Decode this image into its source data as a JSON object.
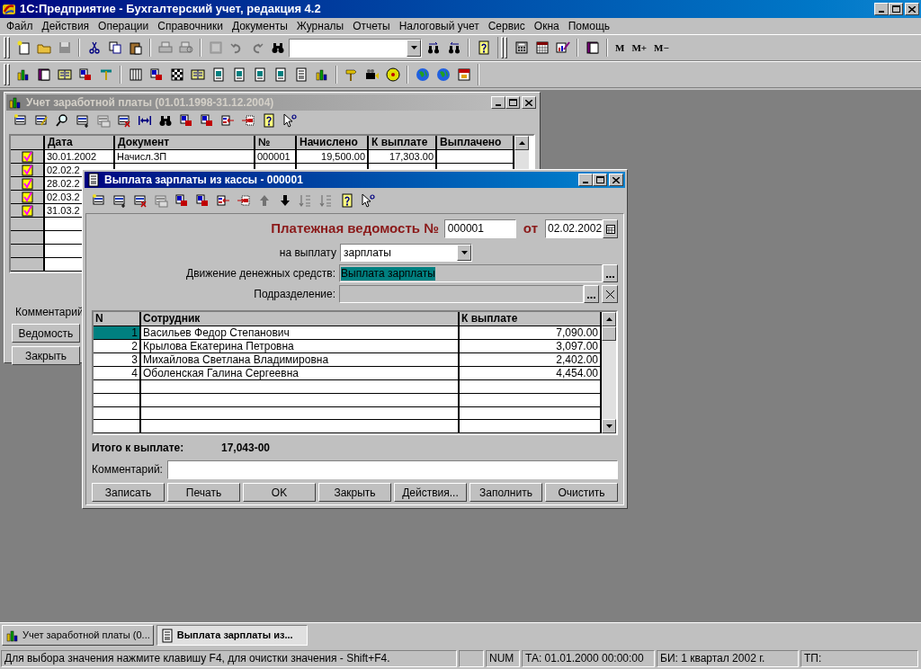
{
  "window": {
    "title": "1С:Предприятие - Бухгалтерский учет, редакция 4.2"
  },
  "menu": [
    "Файл",
    "Действия",
    "Операции",
    "Справочники",
    "Документы",
    "Журналы",
    "Отчеты",
    "Налоговый учет",
    "Сервис",
    "Окна",
    "Помощь"
  ],
  "toolbar_1": [
    {
      "kind": "new",
      "disabled": false
    },
    {
      "kind": "open",
      "disabled": false
    },
    {
      "kind": "save",
      "disabled": true
    },
    {
      "kind": "separator"
    },
    {
      "kind": "cut",
      "disabled": false
    },
    {
      "kind": "copy",
      "disabled": false
    },
    {
      "kind": "paste",
      "disabled": false
    },
    {
      "kind": "separator"
    },
    {
      "kind": "print",
      "disabled": true
    },
    {
      "kind": "preview",
      "disabled": true
    },
    {
      "kind": "separator"
    },
    {
      "kind": "sheet",
      "disabled": true
    },
    {
      "kind": "undo",
      "disabled": true
    },
    {
      "kind": "redo",
      "disabled": true
    },
    {
      "kind": "binoculars",
      "disabled": false
    },
    {
      "kind": "combo"
    },
    {
      "kind": "find-next",
      "disabled": false
    },
    {
      "kind": "find-prev",
      "disabled": false
    },
    {
      "kind": "separator"
    },
    {
      "kind": "help",
      "disabled": false
    },
    {
      "kind": "grip"
    },
    {
      "kind": "calculator",
      "disabled": false
    },
    {
      "kind": "calendar-grid",
      "disabled": false
    },
    {
      "kind": "chart-tool",
      "disabled": false
    },
    {
      "kind": "separator"
    },
    {
      "kind": "book",
      "disabled": false
    },
    {
      "kind": "separator"
    },
    {
      "kind": "text",
      "label": "M",
      "disabled": false
    },
    {
      "kind": "text",
      "label": "M+",
      "disabled": false
    },
    {
      "kind": "text",
      "label": "M−",
      "disabled": false
    }
  ],
  "toolbar_2": [
    {
      "kind": "bar-chart",
      "disabled": false
    },
    {
      "kind": "book",
      "disabled": false
    },
    {
      "kind": "ledger",
      "disabled": false
    },
    {
      "kind": "debit-credit",
      "disabled": false
    },
    {
      "kind": "pin",
      "disabled": false
    },
    {
      "kind": "separator"
    },
    {
      "kind": "columns",
      "disabled": false
    },
    {
      "kind": "debit-credit",
      "disabled": false
    },
    {
      "kind": "checker",
      "disabled": false
    },
    {
      "kind": "ledger",
      "disabled": false
    },
    {
      "kind": "report",
      "disabled": false
    },
    {
      "kind": "report",
      "disabled": false
    },
    {
      "kind": "report",
      "disabled": false
    },
    {
      "kind": "report",
      "disabled": false
    },
    {
      "kind": "document",
      "disabled": false
    },
    {
      "kind": "bar-chart",
      "disabled": false
    },
    {
      "kind": "separator"
    },
    {
      "kind": "signpost",
      "disabled": false
    },
    {
      "kind": "camera",
      "disabled": false
    },
    {
      "kind": "disc",
      "disabled": false
    },
    {
      "kind": "separator"
    },
    {
      "kind": "globe",
      "disabled": false
    },
    {
      "kind": "globe",
      "disabled": false
    },
    {
      "kind": "calendar",
      "disabled": false
    }
  ],
  "journal_window": {
    "title": "Учет заработной платы (01.01.1998-31.12.2004)",
    "active": false,
    "toolbar": [
      {
        "kind": "new-row",
        "disabled": false
      },
      {
        "kind": "edit-row",
        "disabled": false
      },
      {
        "kind": "magnifier",
        "disabled": false
      },
      {
        "kind": "add-row",
        "disabled": false
      },
      {
        "kind": "copy-row",
        "disabled": true
      },
      {
        "kind": "delete-row",
        "disabled": false
      },
      {
        "kind": "double-arrow",
        "disabled": false
      },
      {
        "kind": "binoculars",
        "disabled": false
      },
      {
        "kind": "debit-credit",
        "disabled": false
      },
      {
        "kind": "debit-credit",
        "disabled": false
      },
      {
        "kind": "move-in",
        "disabled": false
      },
      {
        "kind": "move-out",
        "disabled": false
      },
      {
        "kind": "help",
        "disabled": false
      },
      {
        "kind": "pointer-help",
        "disabled": false
      }
    ],
    "columns": [
      "Дата",
      "Документ",
      "№",
      "Начислено",
      "К выплате",
      "Выплачено"
    ],
    "rows": [
      {
        "posted": true,
        "date": "30.01.2002",
        "document": "Начисл.ЗП",
        "number": "000001",
        "accrued": "19,500.00",
        "to_pay": "17,303.00"
      },
      {
        "posted": true,
        "date": "02.02.2"
      },
      {
        "posted": true,
        "date": "28.02.2"
      },
      {
        "posted": true,
        "date": "02.03.2"
      },
      {
        "posted": true,
        "date": "31.03.2"
      }
    ],
    "comment_label": "Комментарий",
    "buttons": [
      "Ведомость",
      "Закрыть"
    ]
  },
  "payment_window": {
    "title": "Выплата зарплаты из кассы - 000001",
    "active": true,
    "toolbar": [
      {
        "kind": "new-row",
        "disabled": false
      },
      {
        "kind": "add-row",
        "disabled": false
      },
      {
        "kind": "delete-row",
        "disabled": false
      },
      {
        "kind": "copy-row",
        "disabled": true
      },
      {
        "kind": "debit-credit",
        "disabled": false
      },
      {
        "kind": "debit-credit",
        "disabled": false
      },
      {
        "kind": "move-in",
        "disabled": false
      },
      {
        "kind": "move-out",
        "disabled": false
      },
      {
        "kind": "arrow-up",
        "disabled": true
      },
      {
        "kind": "arrow-down",
        "disabled": false
      },
      {
        "kind": "sort",
        "disabled": true
      },
      {
        "kind": "sort",
        "disabled": true
      },
      {
        "kind": "help",
        "disabled": false
      },
      {
        "kind": "pointer-help",
        "disabled": false
      }
    ],
    "heading": "Платежная ведомость №",
    "number": "000001",
    "date_label": "от",
    "date": "02.02.2002",
    "pay_for": {
      "label": "на выплату",
      "value": "зарплаты"
    },
    "cash_flow": {
      "label": "Движение денежных средств:",
      "value": "Выплата зарплаты"
    },
    "department": {
      "label": "Подразделение:"
    },
    "columns": [
      "N",
      "Сотрудник",
      "К выплате"
    ],
    "rows": [
      {
        "n": "1",
        "employee": "Васильев Федор Степанович",
        "amount": "7,090.00",
        "selected": true
      },
      {
        "n": "2",
        "employee": "Крылова Екатерина Петровна",
        "amount": "3,097.00",
        "selected": false
      },
      {
        "n": "3",
        "employee": "Михайлова Светлана Владимировна",
        "amount": "2,402.00",
        "selected": false
      },
      {
        "n": "4",
        "employee": "Оболенская Галина Сергеевна",
        "amount": "4,454.00",
        "selected": false
      }
    ],
    "total_label": "Итого к выплате:",
    "total": "17,043-00",
    "comment_label": "Комментарий:",
    "buttons": [
      "Записать",
      "Печать",
      "OK",
      "Закрыть",
      "Действия...",
      "Заполнить",
      "Очистить"
    ]
  },
  "window_tabs": [
    {
      "label": "Учет заработной платы (0...",
      "selected": false
    },
    {
      "label": "Выплата зарплаты из...",
      "selected": true
    }
  ],
  "status_bar": [
    "Для выбора значения нажмите клавишу F4, для очистки значения - Shift+F4.",
    "NUM",
    "ТА: 01.01.2000  00:00:00",
    "БИ: 1 квартал 2002 г.",
    "ТП:"
  ]
}
